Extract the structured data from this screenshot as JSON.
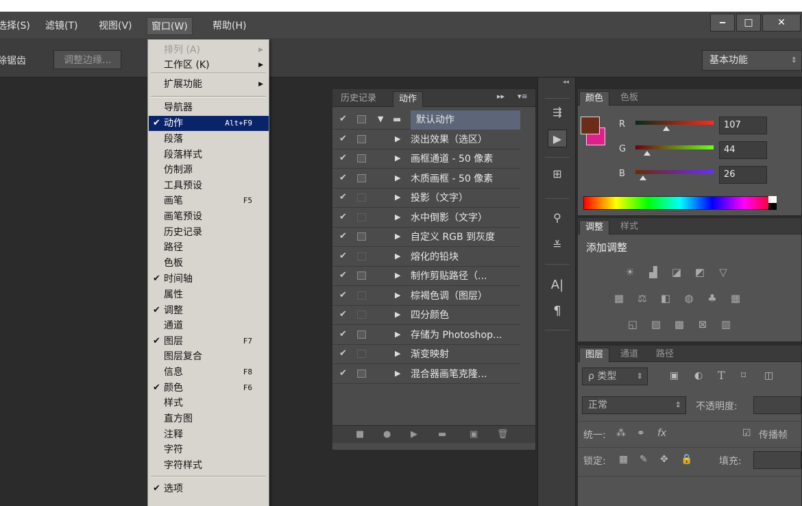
{
  "menubar": {
    "items": [
      {
        "label": "选择(S)"
      },
      {
        "label": "滤镜(T)"
      },
      {
        "label": "视图(V)"
      },
      {
        "label": "窗口(W)"
      },
      {
        "label": "帮助(H)"
      }
    ],
    "window_controls": {
      "minimize": "‒",
      "maximize": "□",
      "close": "✕"
    }
  },
  "optbar": {
    "left_text": "除锯齿",
    "refine_button": "调整边缘...",
    "workspace": "基本功能"
  },
  "dropdown": {
    "items": [
      {
        "label": "排列 (A)",
        "disabled": true,
        "submenu": true,
        "checked": false,
        "shortcut": "",
        "highlighted": false
      },
      {
        "label": "工作区 (K)",
        "disabled": false,
        "submenu": true,
        "checked": false,
        "shortcut": "",
        "highlighted": false
      },
      {
        "label": "扩展功能",
        "disabled": false,
        "submenu": true,
        "checked": false,
        "shortcut": "",
        "highlighted": false
      },
      {
        "label": "导航器",
        "disabled": false,
        "submenu": false,
        "checked": false,
        "shortcut": "",
        "highlighted": false
      },
      {
        "label": "动作",
        "disabled": false,
        "submenu": false,
        "checked": true,
        "shortcut": "Alt+F9",
        "highlighted": true
      },
      {
        "label": "段落",
        "disabled": false,
        "submenu": false,
        "checked": false,
        "shortcut": "",
        "highlighted": false
      },
      {
        "label": "段落样式",
        "disabled": false,
        "submenu": false,
        "checked": false,
        "shortcut": "",
        "highlighted": false
      },
      {
        "label": "仿制源",
        "disabled": false,
        "submenu": false,
        "checked": false,
        "shortcut": "",
        "highlighted": false
      },
      {
        "label": "工具预设",
        "disabled": false,
        "submenu": false,
        "checked": false,
        "shortcut": "",
        "highlighted": false
      },
      {
        "label": "画笔",
        "disabled": false,
        "submenu": false,
        "checked": false,
        "shortcut": "F5",
        "highlighted": false
      },
      {
        "label": "画笔预设",
        "disabled": false,
        "submenu": false,
        "checked": false,
        "shortcut": "",
        "highlighted": false
      },
      {
        "label": "历史记录",
        "disabled": false,
        "submenu": false,
        "checked": false,
        "shortcut": "",
        "highlighted": false
      },
      {
        "label": "路径",
        "disabled": false,
        "submenu": false,
        "checked": false,
        "shortcut": "",
        "highlighted": false
      },
      {
        "label": "色板",
        "disabled": false,
        "submenu": false,
        "checked": false,
        "shortcut": "",
        "highlighted": false
      },
      {
        "label": "时间轴",
        "disabled": false,
        "submenu": false,
        "checked": true,
        "shortcut": "",
        "highlighted": false
      },
      {
        "label": "属性",
        "disabled": false,
        "submenu": false,
        "checked": false,
        "shortcut": "",
        "highlighted": false
      },
      {
        "label": "调整",
        "disabled": false,
        "submenu": false,
        "checked": true,
        "shortcut": "",
        "highlighted": false
      },
      {
        "label": "通道",
        "disabled": false,
        "submenu": false,
        "checked": false,
        "shortcut": "",
        "highlighted": false
      },
      {
        "label": "图层",
        "disabled": false,
        "submenu": false,
        "checked": true,
        "shortcut": "F7",
        "highlighted": false
      },
      {
        "label": "图层复合",
        "disabled": false,
        "submenu": false,
        "checked": false,
        "shortcut": "",
        "highlighted": false
      },
      {
        "label": "信息",
        "disabled": false,
        "submenu": false,
        "checked": false,
        "shortcut": "F8",
        "highlighted": false
      },
      {
        "label": "颜色",
        "disabled": false,
        "submenu": false,
        "checked": true,
        "shortcut": "F6",
        "highlighted": false
      },
      {
        "label": "样式",
        "disabled": false,
        "submenu": false,
        "checked": false,
        "shortcut": "",
        "highlighted": false
      },
      {
        "label": "直方图",
        "disabled": false,
        "submenu": false,
        "checked": false,
        "shortcut": "",
        "highlighted": false
      },
      {
        "label": "注释",
        "disabled": false,
        "submenu": false,
        "checked": false,
        "shortcut": "",
        "highlighted": false
      },
      {
        "label": "字符",
        "disabled": false,
        "submenu": false,
        "checked": false,
        "shortcut": "",
        "highlighted": false
      },
      {
        "label": "字符样式",
        "disabled": false,
        "submenu": false,
        "checked": false,
        "shortcut": "",
        "highlighted": false
      },
      {
        "label": "选项",
        "disabled": false,
        "submenu": false,
        "checked": true,
        "shortcut": "",
        "highlighted": false
      }
    ]
  },
  "actions_panel": {
    "tabs": [
      "历史记录",
      "动作"
    ],
    "active_tab": "动作",
    "rows": [
      {
        "name": "默认动作",
        "is_set": true,
        "dialog": true
      },
      {
        "name": "淡出效果（选区）",
        "is_set": false,
        "dialog": true
      },
      {
        "name": "画框通道 - 50 像素",
        "is_set": false,
        "dialog": true
      },
      {
        "name": "木质画框 - 50 像素",
        "is_set": false,
        "dialog": true
      },
      {
        "name": "投影（文字）",
        "is_set": false,
        "dialog": false
      },
      {
        "name": "水中倒影（文字）",
        "is_set": false,
        "dialog": false
      },
      {
        "name": "自定义 RGB 到灰度",
        "is_set": false,
        "dialog": true
      },
      {
        "name": "熔化的铅块",
        "is_set": false,
        "dialog": false
      },
      {
        "name": "制作剪贴路径（...",
        "is_set": false,
        "dialog": true
      },
      {
        "name": "棕褐色调（图层）",
        "is_set": false,
        "dialog": false
      },
      {
        "name": "四分颜色",
        "is_set": false,
        "dialog": false
      },
      {
        "name": "存储为 Photoshop...",
        "is_set": false,
        "dialog": true
      },
      {
        "name": "渐变映射",
        "is_set": false,
        "dialog": false
      },
      {
        "name": "混合器画笔克隆...",
        "is_set": false,
        "dialog": true
      }
    ]
  },
  "color_panel": {
    "tabs": [
      "颜色",
      "色板"
    ],
    "active_tab": "颜色",
    "fg_color": "#6b2c1a",
    "bg_color": "#e0208a",
    "channels": [
      {
        "label": "R",
        "value": "107"
      },
      {
        "label": "G",
        "value": "44"
      },
      {
        "label": "B",
        "value": "26"
      }
    ]
  },
  "adjust_panel": {
    "tabs": [
      "调整",
      "样式"
    ],
    "active_tab": "调整",
    "heading": "添加调整"
  },
  "layers_panel": {
    "tabs": [
      "图层",
      "通道",
      "路径"
    ],
    "active_tab": "图层",
    "filter_label": "ρ 类型",
    "blend_mode": "正常",
    "opacity_label": "不透明度:",
    "unify_label": "统一:",
    "propagate_label": "传播帧",
    "lock_label": "锁定:",
    "fill_label": "填充:"
  }
}
